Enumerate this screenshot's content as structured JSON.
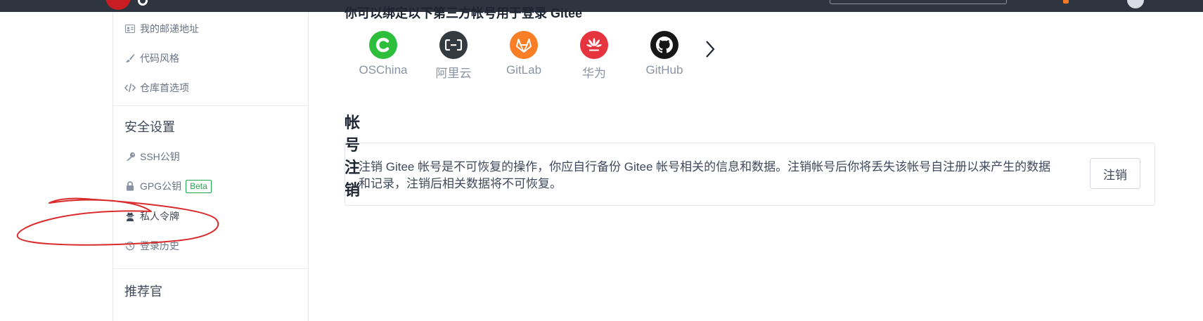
{
  "sidebar": {
    "items_top": [
      {
        "label": "我的邮递地址",
        "icon": "id-card-icon"
      },
      {
        "label": "代码风格",
        "icon": "brush-icon"
      },
      {
        "label": "仓库首选项",
        "icon": "code-icon"
      }
    ],
    "security_heading": "安全设置",
    "security_items": [
      {
        "label": "SSH公钥",
        "icon": "key-icon"
      },
      {
        "label": "GPG公钥",
        "icon": "lock-icon",
        "badge": "Beta"
      },
      {
        "label": "私人令牌",
        "icon": "user-secret-icon"
      },
      {
        "label": "登录历史",
        "icon": "history-icon"
      }
    ],
    "referrer_heading": "推荐官"
  },
  "main": {
    "third_party_title": "你可以绑定以下第三方帐号用于登录 Gitee",
    "providers": [
      {
        "name": "OSChina",
        "icon": "oschina-icon",
        "color": "#2dbe3c"
      },
      {
        "name": "阿里云",
        "icon": "aliyun-icon",
        "color": "#333a40"
      },
      {
        "name": "GitLab",
        "icon": "gitlab-icon",
        "color": "#f97e25"
      },
      {
        "name": "华为",
        "icon": "huawei-icon",
        "color": "#e6343f"
      },
      {
        "name": "GitHub",
        "icon": "github-icon",
        "color": "#181717"
      }
    ],
    "account_cancel": {
      "title": "帐号注销",
      "description": "注销 Gitee 帐号是不可恢复的操作，你应自行备份 Gitee 帐号相关的信息和数据。注销帐号后你将丢失该帐号自注册以来产生的数据和记录，注销后相关数据将不可恢复。",
      "button": "注销"
    }
  },
  "colors": {
    "topbar": "#2e3440",
    "brand": "#c71d23",
    "annotation": "#d92b2b",
    "beta": "#1da84c"
  }
}
